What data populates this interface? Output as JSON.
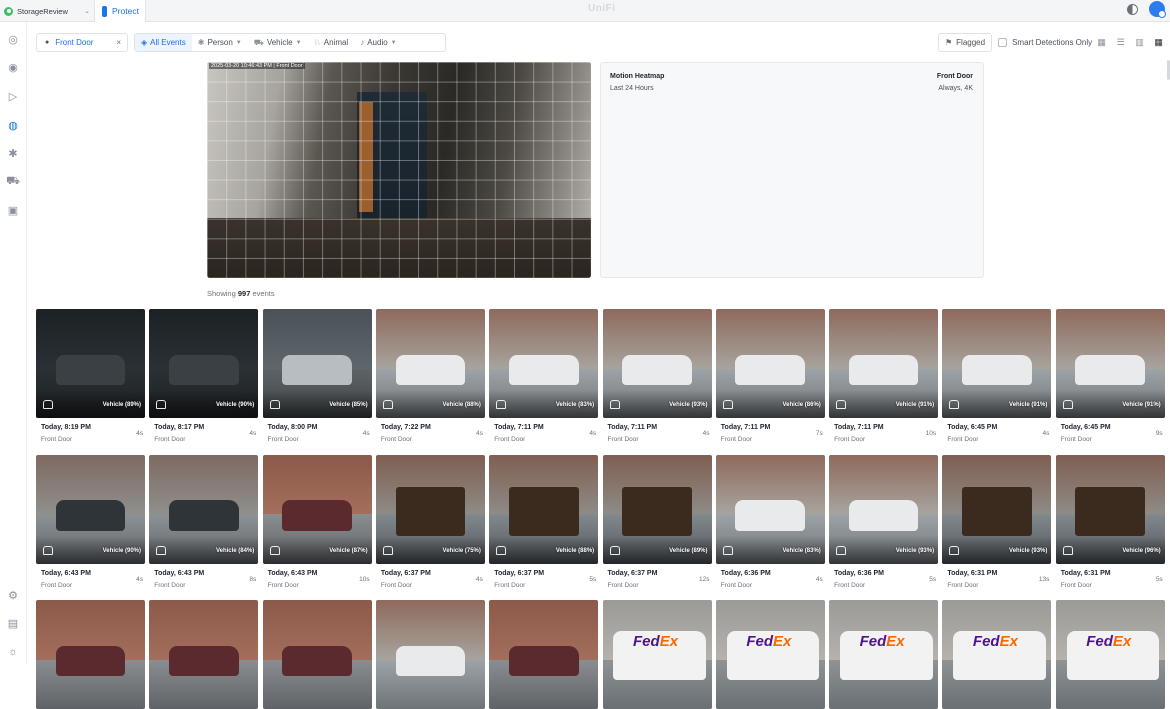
{
  "topbar": {
    "site_name": "StorageReview",
    "app_tab": "Protect",
    "brand": "UniFi"
  },
  "filters": {
    "camera_chip": "Front Door",
    "all_events": "All Events",
    "person": "Person",
    "vehicle": "Vehicle",
    "animal": "Animal",
    "audio": "Audio",
    "flagged": "Flagged",
    "smart_only": "Smart Detections Only"
  },
  "preview": {
    "timestamp": "2025-03-20  10:46:43 PM | Front Door"
  },
  "heatmap": {
    "title": "Motion Heatmap",
    "subtitle": "Last 24 Hours",
    "camera": "Front Door",
    "mode": "Always, 4K"
  },
  "showing": {
    "prefix": "Showing",
    "count": "997",
    "suffix": "events"
  },
  "events": [
    {
      "time": "Today, 8:19 PM",
      "camera": "Front Door",
      "duration": "4s",
      "label": "Vehicle (89%)",
      "scene": "night"
    },
    {
      "time": "Today, 8:17 PM",
      "camera": "Front Door",
      "duration": "4s",
      "label": "Vehicle (90%)",
      "scene": "night"
    },
    {
      "time": "Today, 8:00 PM",
      "camera": "Front Door",
      "duration": "4s",
      "label": "Vehicle (85%)",
      "scene": "dusk"
    },
    {
      "time": "Today, 7:22 PM",
      "camera": "Front Door",
      "duration": "4s",
      "label": "Vehicle (88%)",
      "scene": "day"
    },
    {
      "time": "Today, 7:11 PM",
      "camera": "Front Door",
      "duration": "4s",
      "label": "Vehicle (83%)",
      "scene": "day"
    },
    {
      "time": "Today, 7:11 PM",
      "camera": "Front Door",
      "duration": "4s",
      "label": "Vehicle (93%)",
      "scene": "day"
    },
    {
      "time": "Today, 7:11 PM",
      "camera": "Front Door",
      "duration": "7s",
      "label": "Vehicle (86%)",
      "scene": "day"
    },
    {
      "time": "Today, 7:11 PM",
      "camera": "Front Door",
      "duration": "10s",
      "label": "Vehicle (91%)",
      "scene": "day"
    },
    {
      "time": "Today, 6:45 PM",
      "camera": "Front Door",
      "duration": "4s",
      "label": "Vehicle (91%)",
      "scene": "day"
    },
    {
      "time": "Today, 6:45 PM",
      "camera": "Front Door",
      "duration": "9s",
      "label": "Vehicle (91%)",
      "scene": "day"
    },
    {
      "time": "Today, 6:43 PM",
      "camera": "Front Door",
      "duration": "4s",
      "label": "Vehicle (90%)",
      "scene": "day-dark"
    },
    {
      "time": "Today, 6:43 PM",
      "camera": "Front Door",
      "duration": "8s",
      "label": "Vehicle (84%)",
      "scene": "day-dark"
    },
    {
      "time": "Today, 6:43 PM",
      "camera": "Front Door",
      "duration": "10s",
      "label": "Vehicle (87%)",
      "scene": "brick"
    },
    {
      "time": "Today, 6:37 PM",
      "camera": "Front Door",
      "duration": "4s",
      "label": "Vehicle (75%)",
      "scene": "truck"
    },
    {
      "time": "Today, 6:37 PM",
      "camera": "Front Door",
      "duration": "5s",
      "label": "Vehicle (88%)",
      "scene": "truck"
    },
    {
      "time": "Today, 6:37 PM",
      "camera": "Front Door",
      "duration": "12s",
      "label": "Vehicle (89%)",
      "scene": "truck"
    },
    {
      "time": "Today, 6:36 PM",
      "camera": "Front Door",
      "duration": "4s",
      "label": "Vehicle (83%)",
      "scene": "day"
    },
    {
      "time": "Today, 6:36 PM",
      "camera": "Front Door",
      "duration": "5s",
      "label": "Vehicle (93%)",
      "scene": "day"
    },
    {
      "time": "Today, 6:31 PM",
      "camera": "Front Door",
      "duration": "13s",
      "label": "Vehicle (93%)",
      "scene": "truck"
    },
    {
      "time": "Today, 6:31 PM",
      "camera": "Front Door",
      "duration": "5s",
      "label": "Vehicle (96%)",
      "scene": "truck"
    },
    {
      "time": "",
      "camera": "",
      "duration": "",
      "label": "",
      "scene": "brick"
    },
    {
      "time": "",
      "camera": "",
      "duration": "",
      "label": "",
      "scene": "brick"
    },
    {
      "time": "",
      "camera": "",
      "duration": "",
      "label": "",
      "scene": "brick"
    },
    {
      "time": "",
      "camera": "",
      "duration": "",
      "label": "",
      "scene": "day"
    },
    {
      "time": "",
      "camera": "",
      "duration": "",
      "label": "",
      "scene": "brick"
    },
    {
      "time": "",
      "camera": "",
      "duration": "",
      "label": "",
      "scene": "fedex"
    },
    {
      "time": "",
      "camera": "",
      "duration": "",
      "label": "",
      "scene": "fedex"
    },
    {
      "time": "",
      "camera": "",
      "duration": "",
      "label": "",
      "scene": "fedex"
    },
    {
      "time": "",
      "camera": "",
      "duration": "",
      "label": "",
      "scene": "fedex"
    },
    {
      "time": "",
      "camera": "",
      "duration": "",
      "label": "",
      "scene": "fedex"
    }
  ],
  "colors": {
    "accent": "#1a73e8",
    "site_status": "#3fbf6a"
  }
}
